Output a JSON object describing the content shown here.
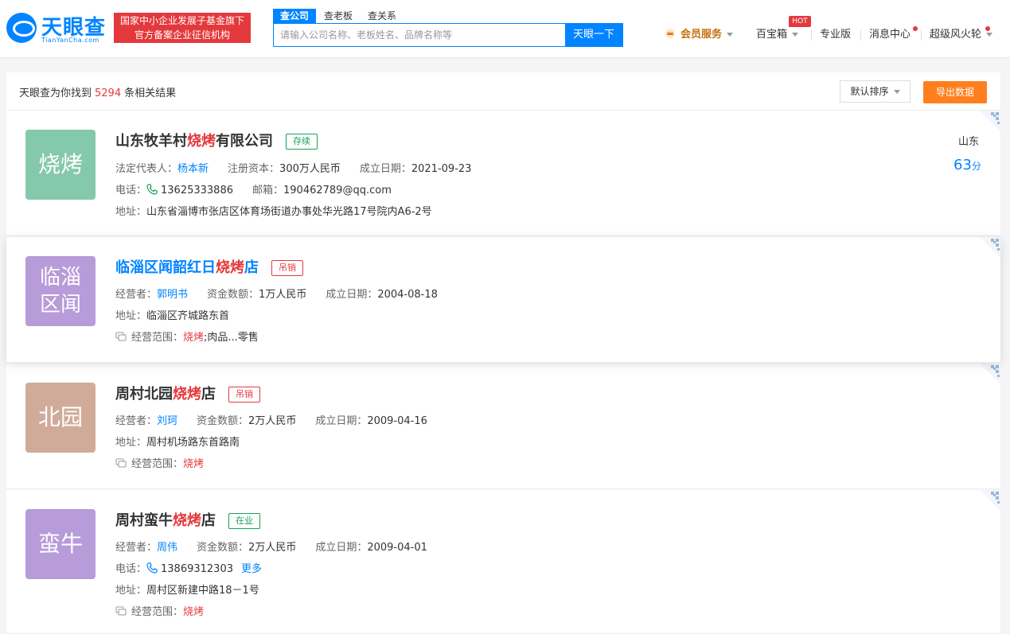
{
  "header": {
    "logo_text": "天眼查",
    "logo_sub": "TianYanCha.com",
    "slogan_line1": "国家中小企业发展子基金旗下",
    "slogan_line2": "官方备案企业征信机构",
    "search_tabs": [
      "查公司",
      "查老板",
      "查关系"
    ],
    "search_placeholder": "请输入公司名称、老板姓名、品牌名称等",
    "search_button": "天眼一下",
    "nav": {
      "vip": "会员服务",
      "treasure": "百宝箱",
      "hot": "HOT",
      "pro": "专业版",
      "messages": "消息中心",
      "fire": "超级风火轮"
    }
  },
  "results": {
    "prefix": "天眼查为你找到",
    "count": "5294",
    "suffix": "条相关结果",
    "sort_label": "默认排序",
    "export_label": "导出数据"
  },
  "companies": [
    {
      "avatar": "烧烤",
      "avatar_color": "#85c9ad",
      "name_pre": "山东牧羊村",
      "name_hl": "烧烤",
      "name_post": "有限公司",
      "status": "存续",
      "rep_label": "法定代表人：",
      "rep": "杨本新",
      "capital_label": "注册资本：",
      "capital": "300万人民币",
      "date_label": "成立日期：",
      "date": "2021-09-23",
      "phone_label": "电话：",
      "phone": "13625333886",
      "email_label": "邮箱：",
      "email": "190462789@qq.com",
      "addr_label": "地址：",
      "addr": "山东省淄博市张店区体育场街道办事处华光路17号院内A6-2号",
      "region": "山东",
      "score": "63",
      "score_unit": "分"
    },
    {
      "avatar": "临淄区闻",
      "avatar_color": "#b89bd9",
      "name_pre": "临淄区闻韶红日",
      "name_hl": "烧烤",
      "name_post": "店",
      "status": "吊销",
      "rep_label": "经营者：",
      "rep": "郭明书",
      "capital_label": "资金数额：",
      "capital": "1万人民币",
      "date_label": "成立日期：",
      "date": "2004-08-18",
      "addr_label": "地址：",
      "addr": "临淄区齐城路东首",
      "scope_label": "经营范围：",
      "scope_hl": "烧烤",
      "scope_rest": ";肉品...零售"
    },
    {
      "avatar": "北园",
      "avatar_color": "#d1ab9a",
      "name_pre": "周村北园",
      "name_hl": "烧烤",
      "name_post": "店",
      "status": "吊销",
      "rep_label": "经营者：",
      "rep": "刘珂",
      "capital_label": "资金数额：",
      "capital": "2万人民币",
      "date_label": "成立日期：",
      "date": "2009-04-16",
      "addr_label": "地址：",
      "addr": "周村机场路东首路南",
      "scope_label": "经营范围：",
      "scope_hl": "烧烤"
    },
    {
      "avatar": "蛮牛",
      "avatar_color": "#b89bd9",
      "name_pre": "周村蛮牛",
      "name_hl": "烧烤",
      "name_post": "店",
      "status": "在业",
      "rep_label": "经营者：",
      "rep": "周伟",
      "capital_label": "资金数额：",
      "capital": "2万人民币",
      "date_label": "成立日期：",
      "date": "2009-04-01",
      "phone_label": "电话：",
      "phone": "13869312303",
      "more": "更多",
      "addr_label": "地址：",
      "addr": "周村区新建中路18－1号",
      "scope_label": "经营范围：",
      "scope_hl": "烧烤"
    }
  ],
  "colors": {
    "brand_blue": "#0084ff",
    "highlight_red": "#e4393c",
    "export_orange": "#ff7f1e",
    "status_green": "#18a058"
  },
  "icons": [
    "logo-eye-icon",
    "crown-icon",
    "caret-down-icon",
    "phone-icon",
    "scope-icon",
    "qr-code-icon"
  ]
}
